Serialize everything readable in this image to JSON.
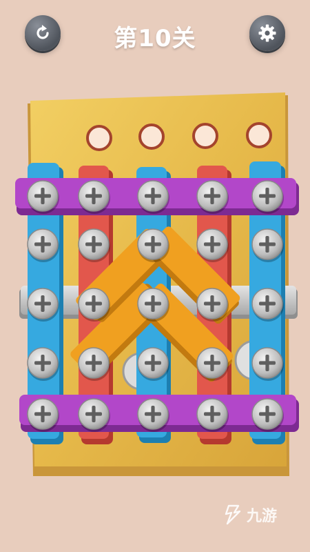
{
  "header": {
    "level_title": "第10关",
    "restart_icon": "restart-icon",
    "settings_icon": "gear-icon"
  },
  "board": {
    "colors": {
      "wood": "#e6b94a",
      "purple": "#b247c9",
      "blue": "#36a9e0",
      "red": "#e2574c",
      "orange": "#f0a020",
      "metal": "#c8c8c8"
    },
    "empty_holes": 4,
    "screws": 25,
    "planks": [
      {
        "name": "purple-bar-top",
        "color": "purple"
      },
      {
        "name": "purple-bar-bottom",
        "color": "purple"
      },
      {
        "name": "blue-bar-left",
        "color": "blue"
      },
      {
        "name": "blue-bar-center",
        "color": "blue"
      },
      {
        "name": "blue-bar-right",
        "color": "blue"
      },
      {
        "name": "red-bar-left",
        "color": "red"
      },
      {
        "name": "red-bar-right",
        "color": "red"
      },
      {
        "name": "orange-bar-upper-left",
        "color": "orange"
      },
      {
        "name": "orange-bar-upper-right",
        "color": "orange"
      },
      {
        "name": "orange-bar-lower-left",
        "color": "orange"
      },
      {
        "name": "orange-bar-lower-right",
        "color": "orange"
      },
      {
        "name": "metal-bar",
        "color": "metal"
      }
    ]
  },
  "watermark": {
    "text": "九游"
  }
}
